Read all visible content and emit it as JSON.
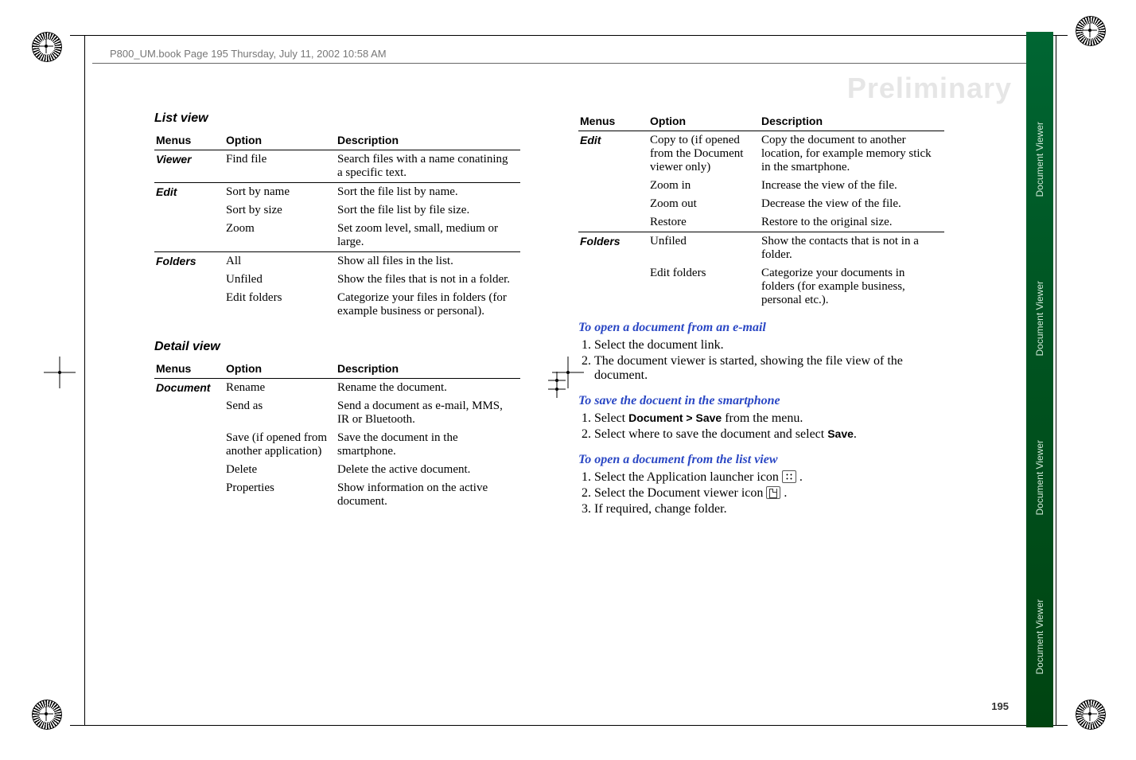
{
  "running_head": "P800_UM.book  Page 195  Thursday, July 11, 2002  10:58 AM",
  "watermark": "Preliminary",
  "page_number": "195",
  "side_tabs": [
    "Document Viewer",
    "Document Viewer",
    "Document Viewer",
    "Document Viewer"
  ],
  "left": {
    "section1_title": "List view",
    "table1": {
      "headers": [
        "Menus",
        "Option",
        "Description"
      ],
      "groups": [
        {
          "menu": "Viewer",
          "rows": [
            {
              "option": "Find file",
              "desc": "Search files with a name conatining a specific text."
            }
          ]
        },
        {
          "menu": "Edit",
          "rows": [
            {
              "option": "Sort by name",
              "desc": "Sort the file list by name."
            },
            {
              "option": "Sort by size",
              "desc": "Sort the file list by file size."
            },
            {
              "option": "Zoom",
              "desc": "Set zoom level, small, medium or large."
            }
          ]
        },
        {
          "menu": "Folders",
          "rows": [
            {
              "option": "All",
              "desc": "Show all files in the list."
            },
            {
              "option": "Unfiled",
              "desc": "Show the files that is not in a folder."
            },
            {
              "option": "Edit folders",
              "desc": "Categorize your files in folders (for example business or personal)."
            }
          ]
        }
      ]
    },
    "section2_title": "Detail view",
    "table2": {
      "headers": [
        "Menus",
        "Option",
        "Description"
      ],
      "groups": [
        {
          "menu": "Document",
          "rows": [
            {
              "option": "Rename",
              "desc": "Rename the document."
            },
            {
              "option": "Send as",
              "desc": "Send a document as e-mail, MMS, IR or Bluetooth."
            },
            {
              "option": "Save (if opened from another application)",
              "desc": "Save the document in the smartphone."
            },
            {
              "option": "Delete",
              "desc": "Delete the active document."
            },
            {
              "option": "Properties",
              "desc": "Show information on the active document."
            }
          ]
        }
      ]
    }
  },
  "right": {
    "table3": {
      "headers": [
        "Menus",
        "Option",
        "Description"
      ],
      "groups": [
        {
          "menu": "Edit",
          "rows": [
            {
              "option": "Copy to (if opened from the Document viewer only)",
              "desc": "Copy the document to another location, for example memory stick in the smartphone."
            },
            {
              "option": "Zoom in",
              "desc": "Increase the view of the file."
            },
            {
              "option": "Zoom out",
              "desc": "Decrease the view of the file."
            },
            {
              "option": "Restore",
              "desc": "Restore to the original size."
            }
          ]
        },
        {
          "menu": "Folders",
          "rows": [
            {
              "option": "Unfiled",
              "desc": "Show the contacts that is not in a folder."
            },
            {
              "option": "Edit folders",
              "desc": "Categorize your documents in folders (for example business, personal etc.)."
            }
          ]
        }
      ]
    },
    "procedures": [
      {
        "title": "To open a document from an e-mail",
        "steps": [
          "Select the document link.",
          "The document viewer is started, showing the file view of the document."
        ]
      },
      {
        "title": "To save the docuent in the smartphone",
        "steps_html": [
          "Select <span class='sans-b'>Document &gt; Save</span> from the menu.",
          "Select where to save the document and select <span class='sans-b'>Save</span>."
        ]
      },
      {
        "title": "To open a document from the list view",
        "steps_html": [
          "Select the Application launcher icon <span class='inline-icon grid' data-name='app-launcher-icon' data-interactable='false'></span> .",
          "Select the Document viewer icon <span class='inline-icon doc' data-name='document-viewer-icon' data-interactable='false'></span> .",
          "If required, change folder."
        ]
      }
    ]
  }
}
